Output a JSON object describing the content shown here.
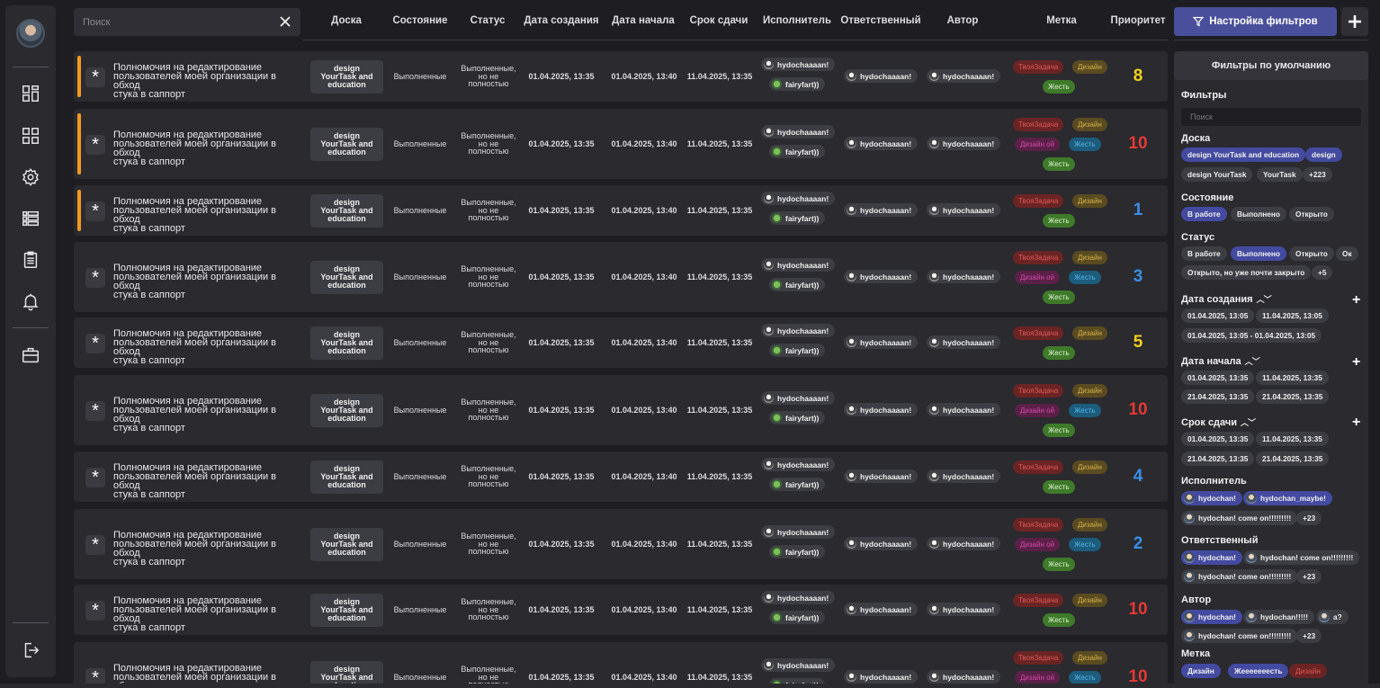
{
  "search": {
    "placeholder": "Поиск"
  },
  "columns": {
    "board": "Доска",
    "state": "Состояние",
    "status": "Статус",
    "created": "Дата создания",
    "start": "Дата начала",
    "due": "Срок сдачи",
    "assignee": "Исполнитель",
    "responsible": "Ответственный",
    "author": "Автор",
    "tag": "Метка",
    "priority": "Приоритет"
  },
  "filter_button": "Настройка фильтров",
  "row_common": {
    "title_l1": "Полномочия на редактирование",
    "title_l2": "пользователей моей организации в обход",
    "title_l3": "стука в саппорт",
    "board_l1": "design",
    "board_l2": "YourTask and",
    "board_l3": "education",
    "state": "Выполненные",
    "status_l1": "Выполненные,",
    "status_l2": "но не",
    "status_l3": "полностью",
    "created": "01.04.2025, 13:35",
    "start": "01.04.2025, 13:40",
    "due": "11.04.2025, 13:35",
    "user1": "hydochaaaan!",
    "user2": "fairyfart))"
  },
  "tag_labels": {
    "red": "ТвояЗадача",
    "yellow": "Дизайн",
    "magenta": "Дизайн ой",
    "blue": "Жесть",
    "green": "Жесть"
  },
  "rows": [
    {
      "priority": "8",
      "priority_color": "#f5d21c",
      "accent": true,
      "tags": "3a"
    },
    {
      "priority": "10",
      "priority_color": "#e53935",
      "accent": true,
      "tags": "5"
    },
    {
      "priority": "1",
      "priority_color": "#3a8ee6",
      "accent": true,
      "tags": "3a"
    },
    {
      "priority": "3",
      "priority_color": "#3a8ee6",
      "accent": false,
      "tags": "5"
    },
    {
      "priority": "5",
      "priority_color": "#f5d21c",
      "accent": false,
      "tags": "3a"
    },
    {
      "priority": "10",
      "priority_color": "#e53935",
      "accent": false,
      "tags": "5"
    },
    {
      "priority": "4",
      "priority_color": "#3a8ee6",
      "accent": false,
      "tags": "3a"
    },
    {
      "priority": "2",
      "priority_color": "#3a8ee6",
      "accent": false,
      "tags": "5"
    },
    {
      "priority": "10",
      "priority_color": "#e53935",
      "accent": false,
      "tags": "3a"
    },
    {
      "priority": "10",
      "priority_color": "#e53935",
      "accent": false,
      "tags": "5"
    }
  ],
  "panel": {
    "title": "Фильтры по умолчанию",
    "filters_label": "Фильтры",
    "search_placeholder": "Поиск",
    "board_label": "Доска",
    "board_pills": [
      "design YourTask and education",
      "design",
      "design YourTask",
      "YourTask",
      "+223"
    ],
    "state_label": "Состояние",
    "state_pills": [
      "В работе",
      "Выполнено",
      "Открыто"
    ],
    "status_label": "Статус",
    "status_pills": [
      "В работе",
      "Выполнено",
      "Открыто",
      "Ок",
      "Открыто, но уже почти закрыто",
      "+5"
    ],
    "created_label": "Дата создания",
    "created_pills": [
      "01.04.2025, 13:05",
      "11.04.2025, 13:05",
      "01.04.2025, 13:05 - 01.04.2025, 13:05"
    ],
    "start_label": "Дата начала",
    "start_pills": [
      "01.04.2025, 13:35",
      "11.04.2025, 13:35",
      "21.04.2025, 13:35",
      "21.04.2025, 13:35"
    ],
    "due_label": "Срок сдачи",
    "due_pills": [
      "01.04.2025, 13:35",
      "11.04.2025, 13:35",
      "21.04.2025, 13:35",
      "21.04.2025, 13:35"
    ],
    "assignee_label": "Исполнитель",
    "assignee_pills": [
      "hydochan!",
      "hydochan_maybe!",
      "hydochan! come on!!!!!!!!!",
      "+23"
    ],
    "responsible_label": "Ответственный",
    "responsible_pills": [
      "hydochan!",
      "hydochan! come on!!!!!!!!!",
      "hydochan! come on!!!!!!!!!",
      "+23"
    ],
    "author_label": "Автор",
    "author_pills": [
      "hydochan!",
      "hydochan!!!!!",
      "a?",
      "hydochan! come on!!!!!!!!!",
      "+23"
    ],
    "tag_label": "Метка",
    "tag_pills": [
      "Дизайн",
      "Жееееееесть",
      "Дизайн"
    ]
  },
  "colors": {
    "accent": "#4a4f9c",
    "orange_marker": "#f39a1e",
    "background": "#1e1e22",
    "card": "#2a2a2f"
  }
}
